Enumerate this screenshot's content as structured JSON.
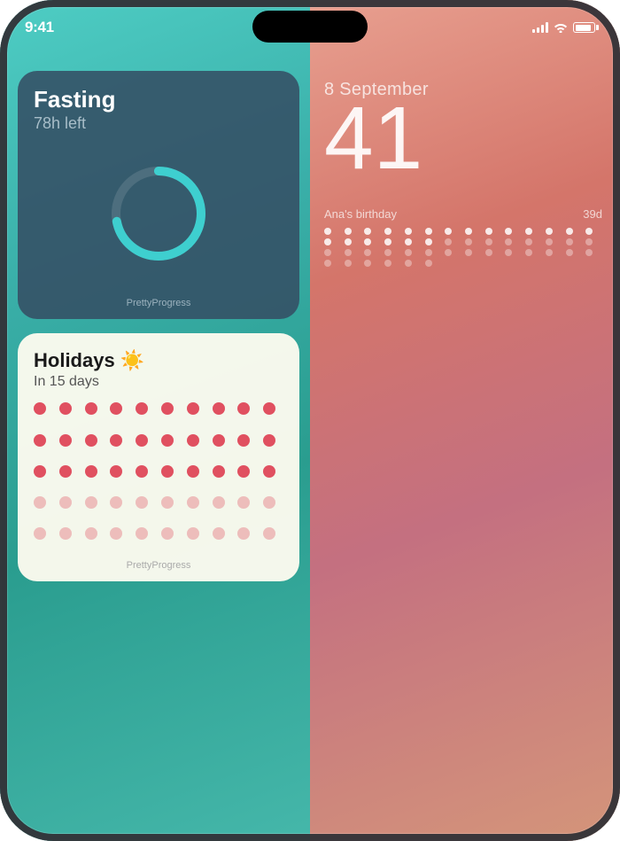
{
  "status_bar": {
    "time": "9:41",
    "signal_label": "signal",
    "wifi_label": "wifi",
    "battery_label": "battery"
  },
  "fasting_widget": {
    "title": "Fasting",
    "subtitle": "78h left",
    "brand": "PrettyProgress",
    "progress_pct": 72,
    "progress_color": "#3ecfcf",
    "track_color": "rgba(255,255,255,0.12)"
  },
  "holidays_widget": {
    "title": "Holidays ☀️",
    "subtitle": "In 15 days",
    "brand": "PrettyProgress",
    "dot_rows": 5,
    "dot_cols": 10,
    "filled_dots": 30,
    "total_dots": 50
  },
  "date_widget": {
    "month": "8 September",
    "day": "41",
    "birthday_label": "Ana's birthday",
    "birthday_days": "39d"
  },
  "dot_grid_right": {
    "bright_count": 20,
    "dim_count": 28,
    "cols": 14
  }
}
